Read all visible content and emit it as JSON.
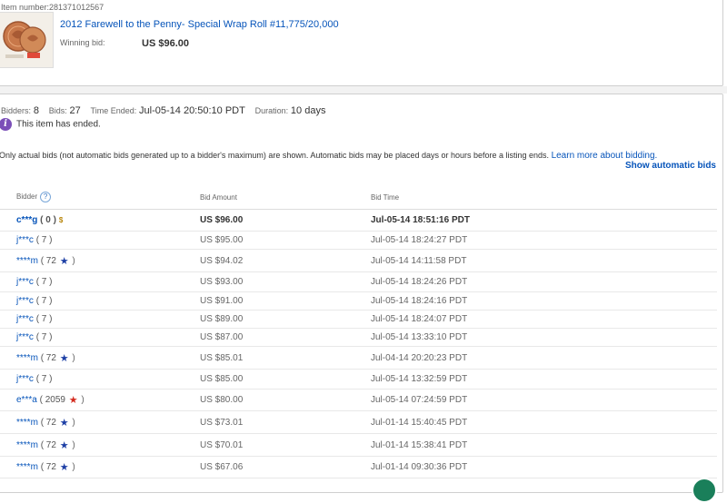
{
  "item": {
    "number_label": "Item number:",
    "number": "281371012567",
    "title": "2012 Farewell to the Penny- Special Wrap Roll #11,775/20,000",
    "winning_label": "Winning bid:",
    "winning_value": "US $96.00"
  },
  "summary": {
    "bidders_label": "Bidders:",
    "bidders": "8",
    "bids_label": "Bids:",
    "bids": "27",
    "time_ended_label": "Time Ended:",
    "time_ended": "Jul-05-14 20:50:10 PDT",
    "duration_label": "Duration:",
    "duration": "10 days"
  },
  "ended_notice": "This item has ended.",
  "disclaimer": {
    "text": "Only actual bids (not automatic bids generated up to a bidder's maximum) are shown. Automatic bids may be placed days or hours before a listing ends.",
    "link": "Learn more about bidding."
  },
  "show_automatic": "Show automatic bids",
  "table": {
    "headers": {
      "bidder": "Bidder",
      "amount": "Bid Amount",
      "time": "Bid Time"
    },
    "rows": [
      {
        "bidder": "c***g",
        "feedback": "( 0 )",
        "star": "",
        "amount": "US $96.00",
        "time": "Jul-05-14 18:51:16 PDT"
      },
      {
        "bidder": "j***c",
        "feedback": "( 7 )",
        "star": "",
        "amount": "US $95.00",
        "time": "Jul-05-14 18:24:27 PDT"
      },
      {
        "bidder": "****m",
        "feedback": "( 72",
        "star": "blue",
        "amount": "US $94.02",
        "time": "Jul-05-14 14:11:58 PDT"
      },
      {
        "bidder": "j***c",
        "feedback": "( 7 )",
        "star": "",
        "amount": "US $93.00",
        "time": "Jul-05-14 18:24:26 PDT"
      },
      {
        "bidder": "j***c",
        "feedback": "( 7 )",
        "star": "",
        "amount": "US $91.00",
        "time": "Jul-05-14 18:24:16 PDT"
      },
      {
        "bidder": "j***c",
        "feedback": "( 7 )",
        "star": "",
        "amount": "US $89.00",
        "time": "Jul-05-14 18:24:07 PDT"
      },
      {
        "bidder": "j***c",
        "feedback": "( 7 )",
        "star": "",
        "amount": "US $87.00",
        "time": "Jul-05-14 13:33:10 PDT"
      },
      {
        "bidder": "****m",
        "feedback": "( 72",
        "star": "blue",
        "amount": "US $85.01",
        "time": "Jul-04-14 20:20:23 PDT"
      },
      {
        "bidder": "j***c",
        "feedback": "( 7 )",
        "star": "",
        "amount": "US $85.00",
        "time": "Jul-05-14 13:32:59 PDT"
      },
      {
        "bidder": "e***a",
        "feedback": "( 2059",
        "star": "red",
        "amount": "US $80.00",
        "time": "Jul-05-14 07:24:59 PDT"
      },
      {
        "bidder": "****m",
        "feedback": "( 72",
        "star": "blue",
        "amount": "US $73.01",
        "time": "Jul-01-14 15:40:45 PDT"
      },
      {
        "bidder": "****m",
        "feedback": "( 72",
        "star": "blue",
        "amount": "US $70.01",
        "time": "Jul-01-14 15:38:41 PDT"
      },
      {
        "bidder": "****m",
        "feedback": "( 72",
        "star": "blue",
        "amount": "US $67.06",
        "time": "Jul-01-14 09:30:36 PDT"
      }
    ]
  }
}
